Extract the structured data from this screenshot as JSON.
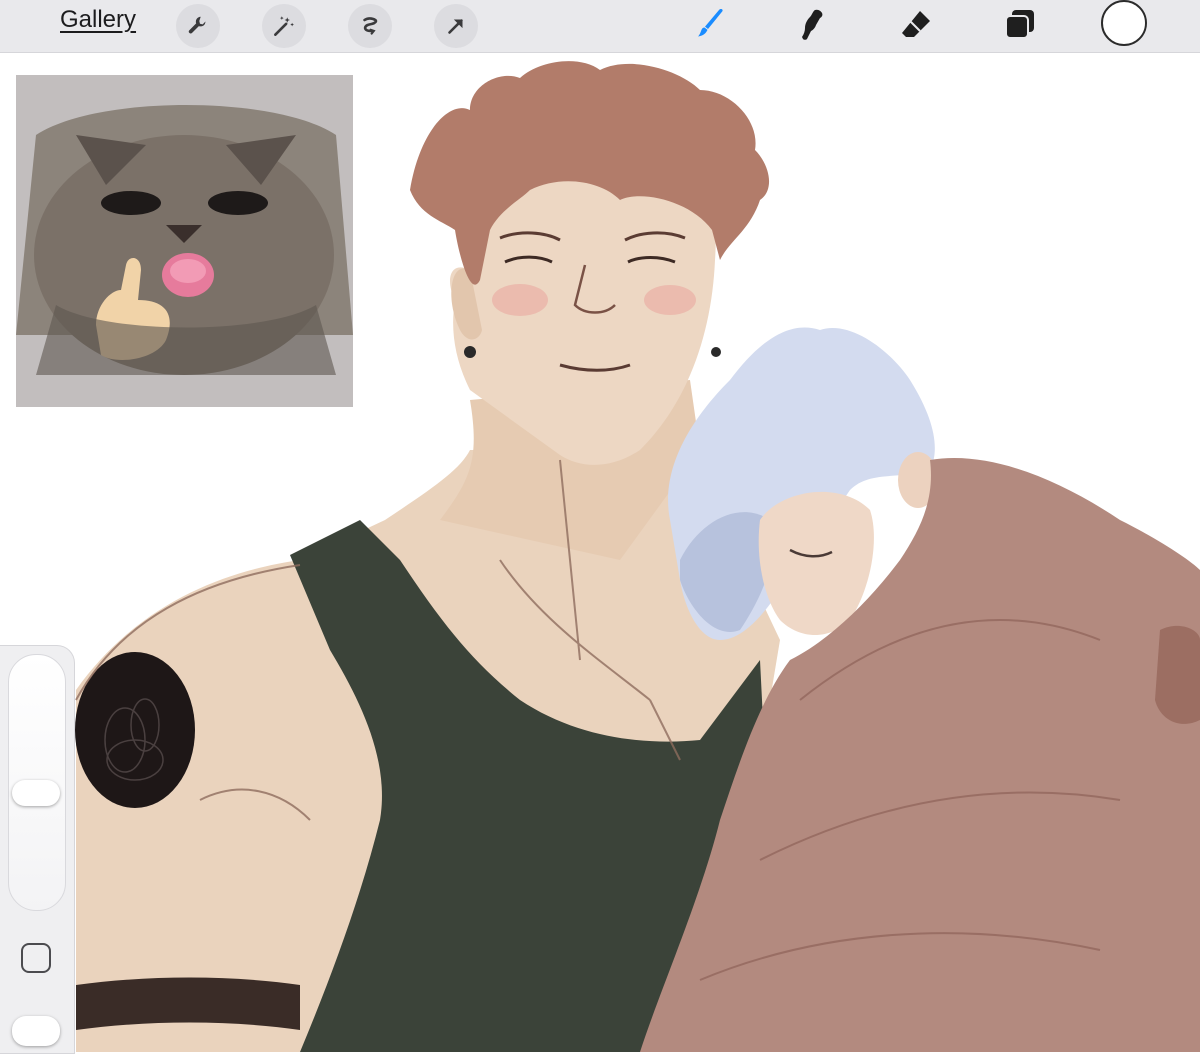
{
  "toolbar": {
    "gallery_label": "Gallery",
    "left_tools": [
      "wrench-icon",
      "magic-wand-icon",
      "selection-icon",
      "transform-arrow-icon"
    ],
    "right_tools": [
      "brush-icon",
      "smudge-icon",
      "eraser-icon",
      "layers-icon"
    ],
    "active_tool": "brush-icon",
    "accent_color": "#1a8cff",
    "current_color": "#ffffff"
  },
  "sidebar": {
    "size_slider": "brush-size",
    "opacity_slider": "brush-opacity",
    "modify_button": "modify-square"
  },
  "canvas": {
    "background": "#ffffff",
    "skin_color": "#ead3bd",
    "hair_color": "#b27c6a",
    "tank_top_color": "#3b4339",
    "blanket_color": "#b38a7f",
    "silver_hair_color": "#cfd6ea"
  },
  "reference_image": {
    "subject": "cat-thumbs-up"
  }
}
